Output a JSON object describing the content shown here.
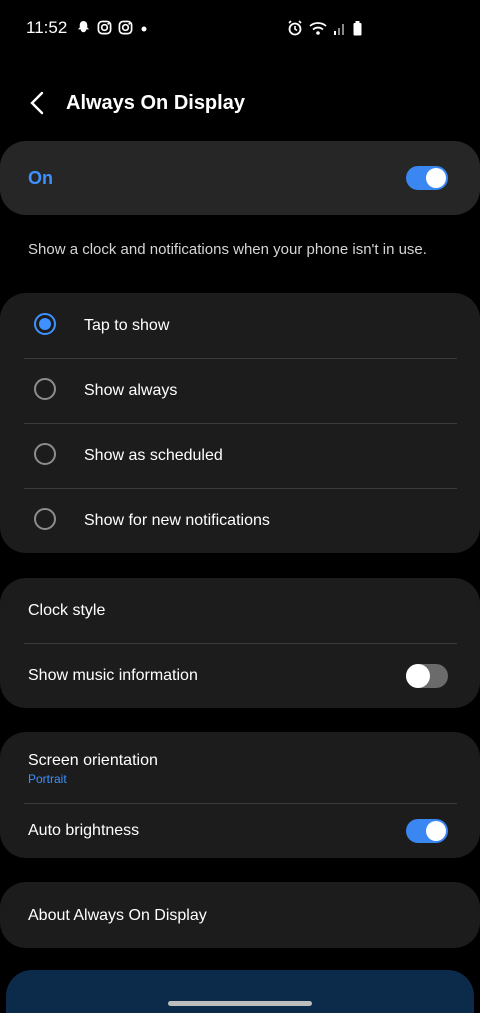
{
  "status_bar": {
    "time": "11:52",
    "left_icons": [
      "ghost-icon",
      "instagram-icon",
      "instagram-icon",
      "dot-icon"
    ],
    "right_icons": [
      "alarm-icon",
      "wifi-icon",
      "signal-icon",
      "battery-icon"
    ]
  },
  "header": {
    "title": "Always On Display"
  },
  "master_switch": {
    "label": "On",
    "state": true
  },
  "description": "Show a clock and notifications when your phone isn't in use.",
  "display_mode": {
    "options": [
      {
        "label": "Tap to show",
        "selected": true
      },
      {
        "label": "Show always",
        "selected": false
      },
      {
        "label": "Show as scheduled",
        "selected": false
      },
      {
        "label": "Show for new notifications",
        "selected": false
      }
    ]
  },
  "clock_group": {
    "clock_style": "Clock style",
    "music_info": "Show music information",
    "music_info_state": false
  },
  "orientation_group": {
    "screen_orientation": "Screen orientation",
    "screen_orientation_value": "Portrait",
    "auto_brightness": "Auto brightness",
    "auto_brightness_state": true
  },
  "about": {
    "label": "About Always On Display"
  },
  "colors": {
    "accent": "#3e91ff",
    "card": "#1c1c1c",
    "background": "#000000"
  }
}
